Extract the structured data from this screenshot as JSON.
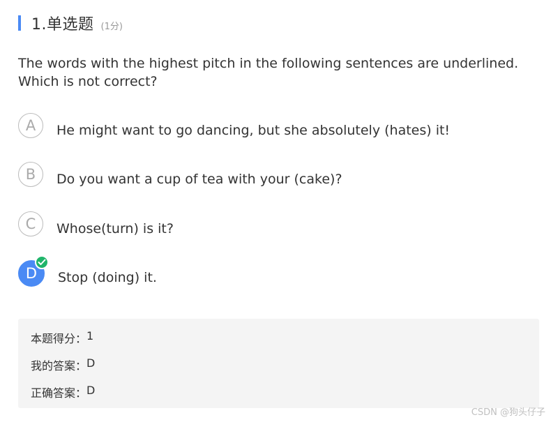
{
  "question": {
    "title": "1.单选题",
    "score": "(1分)",
    "text": "The words with the highest pitch in the following sentences are underlined. Which is not correct?"
  },
  "options": [
    {
      "letter": "A",
      "text": "He might want to go dancing, but she absolutely (hates) it!",
      "selected": false
    },
    {
      "letter": "B",
      "text": "Do you want a cup of tea with your (cake)?",
      "selected": false
    },
    {
      "letter": "C",
      "text": "Whose(turn) is it?",
      "selected": false
    },
    {
      "letter": "D",
      "text": "Stop (doing) it.",
      "selected": true
    }
  ],
  "result": {
    "score_label": "本题得分：",
    "score_value": "1",
    "my_answer_label": "我的答案：",
    "my_answer_value": "D",
    "correct_answer_label": "正确答案：",
    "correct_answer_value": "D"
  },
  "icons": {
    "correct": "checkmark-icon"
  },
  "colors": {
    "accent": "#4a8af4",
    "correct": "#1fb56a"
  },
  "watermark": "CSDN @狗头仔子"
}
